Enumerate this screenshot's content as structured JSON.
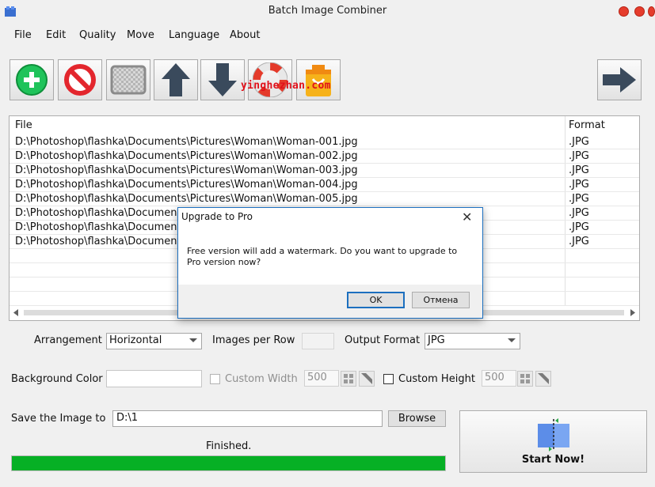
{
  "window": {
    "title": "Batch Image Combiner"
  },
  "menu": [
    "File",
    "Edit",
    "Quality",
    "Move",
    "Language",
    "About"
  ],
  "toolbar": {
    "buttons": [
      "add-icon",
      "remove-icon",
      "clear-icon",
      "move-up-icon",
      "move-down-icon",
      "help-icon",
      "shop-icon"
    ],
    "next": "arrow-right-icon",
    "watermark_text": "yinghezhan.com"
  },
  "filelist": {
    "headers": {
      "file": "File",
      "format": "Format"
    },
    "rows": [
      {
        "file": "D:\\Photoshop\\flashka\\Documents\\Pictures\\Woman\\Woman-001.jpg",
        "format": ".JPG"
      },
      {
        "file": "D:\\Photoshop\\flashka\\Documents\\Pictures\\Woman\\Woman-002.jpg",
        "format": ".JPG"
      },
      {
        "file": "D:\\Photoshop\\flashka\\Documents\\Pictures\\Woman\\Woman-003.jpg",
        "format": ".JPG"
      },
      {
        "file": "D:\\Photoshop\\flashka\\Documents\\Pictures\\Woman\\Woman-004.jpg",
        "format": ".JPG"
      },
      {
        "file": "D:\\Photoshop\\flashka\\Documents\\Pictures\\Woman\\Woman-005.jpg",
        "format": ".JPG"
      },
      {
        "file": "D:\\Photoshop\\flashka\\Document",
        "format": ".JPG"
      },
      {
        "file": "D:\\Photoshop\\flashka\\Document",
        "format": ".JPG"
      },
      {
        "file": "D:\\Photoshop\\flashka\\Document",
        "format": ".JPG"
      }
    ]
  },
  "dialog": {
    "title": "Upgrade to Pro",
    "message": "Free version will add a watermark. Do you want to upgrade to Pro version now?",
    "ok": "OK",
    "cancel": "Отмена"
  },
  "settings": {
    "arrangement_label": "Arrangement",
    "arrangement_value": "Horizontal",
    "images_per_row_label": "Images per Row",
    "images_per_row_value": "",
    "output_format_label": "Output Format",
    "output_format_value": "JPG",
    "background_color_label": "Background Color",
    "custom_width_label": "Custom Width",
    "custom_width_value": "500",
    "custom_height_label": "Custom Height",
    "custom_height_value": "500",
    "save_label": "Save the Image to",
    "save_path": "D:\\1",
    "browse": "Browse"
  },
  "status": {
    "text": "Finished.",
    "progress": 1.0
  },
  "start": {
    "label": "Start Now!"
  },
  "colors": {
    "progress": "#06b025",
    "accent": "#1c6fbf",
    "close": "#e53c2c"
  }
}
